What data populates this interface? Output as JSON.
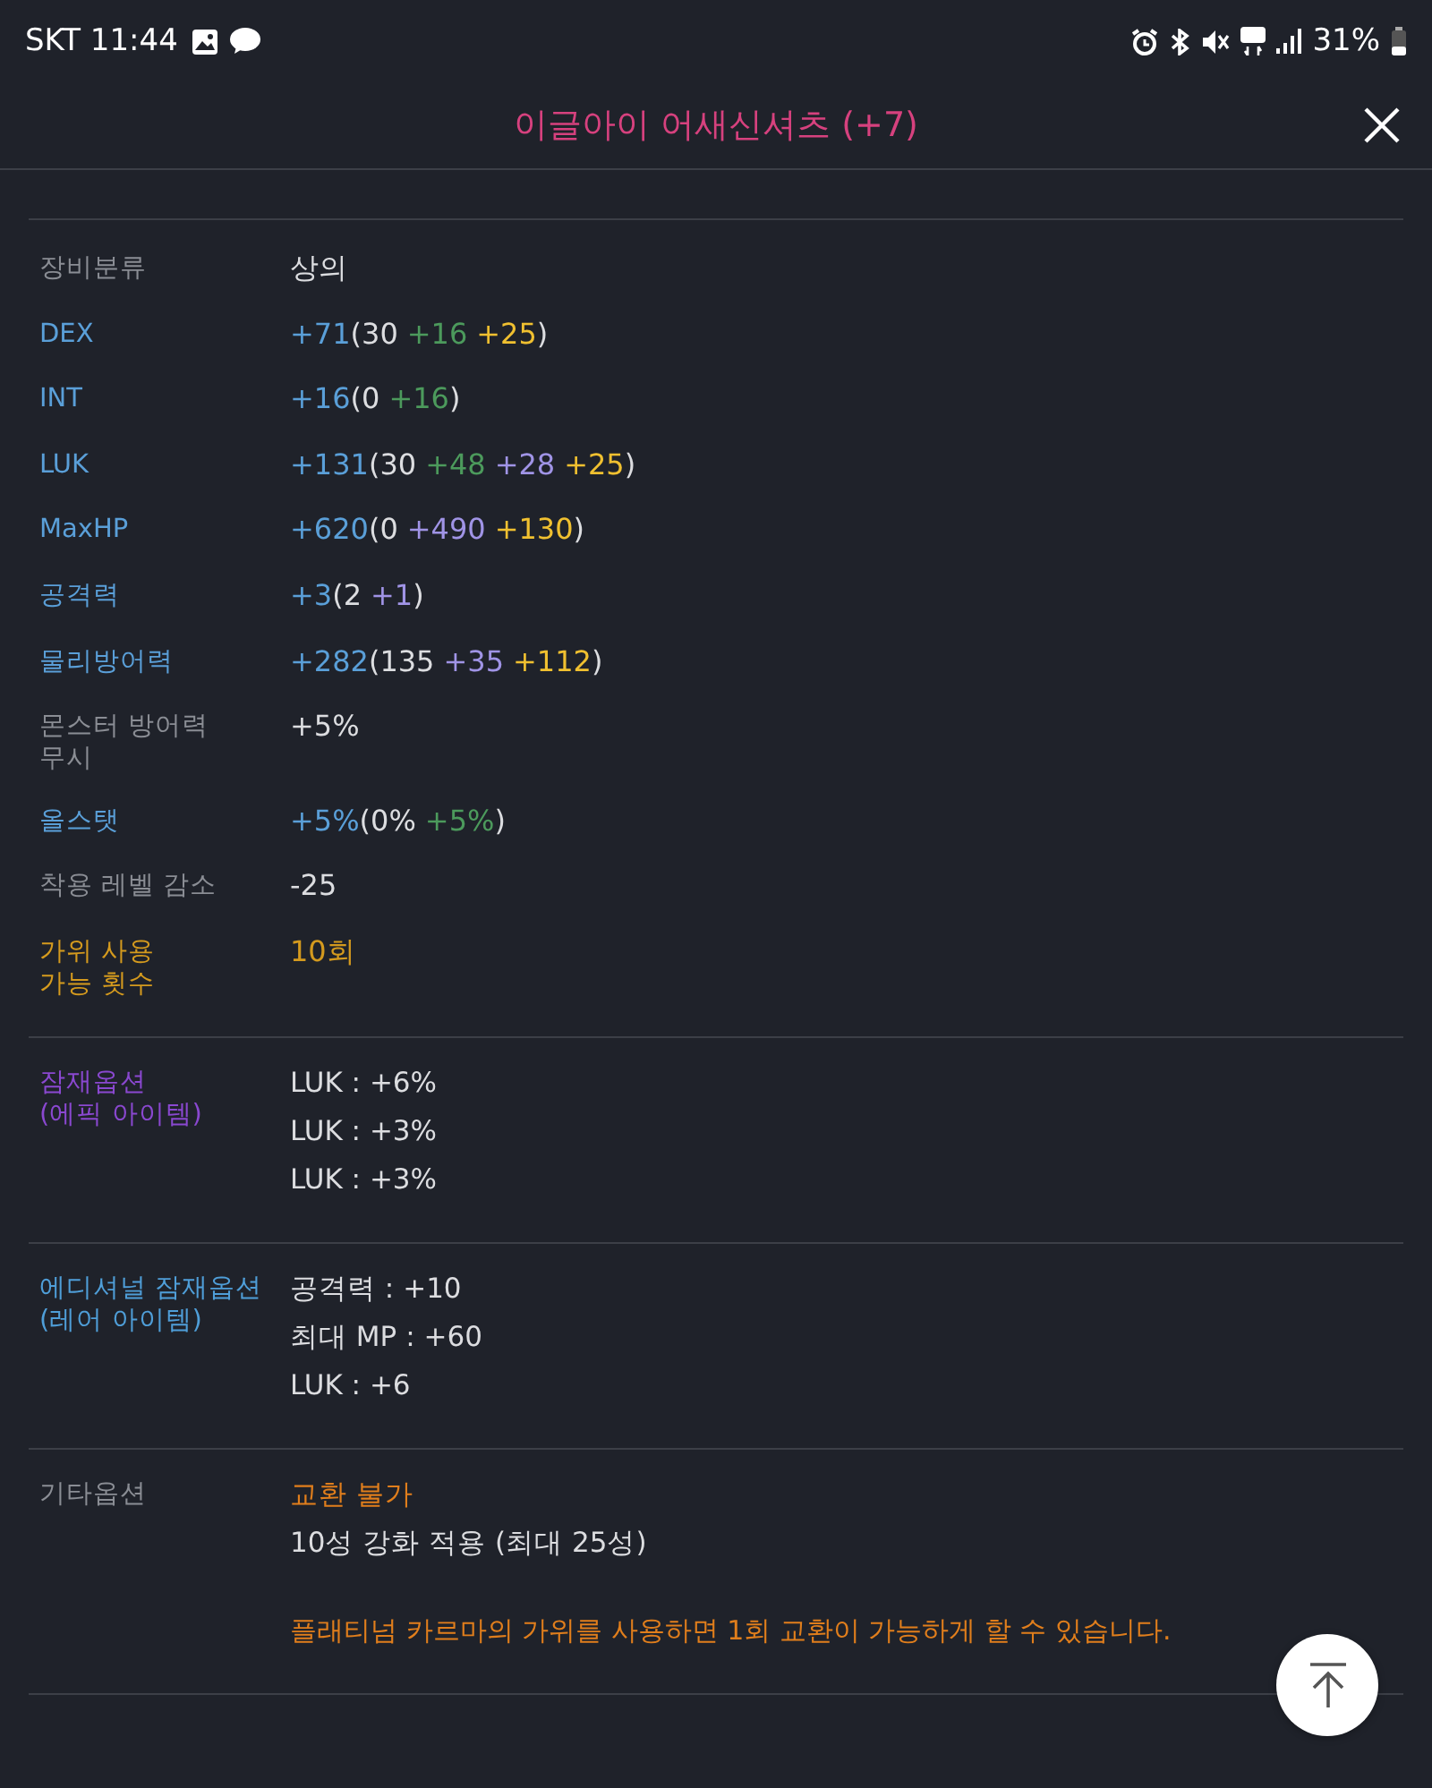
{
  "status_bar": {
    "carrier_time": "SKT 11:44",
    "battery": "31%"
  },
  "header": {
    "title": "이글아이 어새신셔츠 (+7)"
  },
  "sections": [
    {
      "rows": [
        {
          "label": [
            "장비분류"
          ],
          "color": "#8a8d94",
          "value": [
            {
              "text": "상의",
              "color": "#dcdde0"
            }
          ]
        },
        {
          "label": [
            "DEX"
          ],
          "color": "#5a9fd8",
          "value": [
            {
              "text": "+71",
              "color": "#5a9fd8"
            },
            {
              "text": "(30",
              "color": "#dcdde0"
            },
            {
              "text": "+16",
              "color": "#4c9a5c"
            },
            {
              "text": "+25",
              "color": "#f0c030"
            },
            {
              "text": ")",
              "color": "#dcdde0"
            }
          ]
        },
        {
          "label": [
            "INT"
          ],
          "color": "#5a9fd8",
          "value": [
            {
              "text": "+16",
              "color": "#5a9fd8"
            },
            {
              "text": "(0",
              "color": "#dcdde0"
            },
            {
              "text": "+16",
              "color": "#4c9a5c"
            },
            {
              "text": ")",
              "color": "#dcdde0"
            }
          ]
        },
        {
          "label": [
            "LUK"
          ],
          "color": "#5a9fd8",
          "value": [
            {
              "text": "+131",
              "color": "#5a9fd8"
            },
            {
              "text": "(30",
              "color": "#dcdde0"
            },
            {
              "text": "+48",
              "color": "#4c9a5c"
            },
            {
              "text": "+28",
              "color": "#a094e6"
            },
            {
              "text": "+25",
              "color": "#f0c030"
            },
            {
              "text": ")",
              "color": "#dcdde0"
            }
          ]
        },
        {
          "label": [
            "MaxHP"
          ],
          "color": "#5a9fd8",
          "value": [
            {
              "text": "+620",
              "color": "#5a9fd8"
            },
            {
              "text": "(0",
              "color": "#dcdde0"
            },
            {
              "text": "+490",
              "color": "#a094e6"
            },
            {
              "text": "+130",
              "color": "#f0c030"
            },
            {
              "text": ")",
              "color": "#dcdde0"
            }
          ]
        },
        {
          "label": [
            "공격력"
          ],
          "color": "#5a9fd8",
          "value": [
            {
              "text": "+3",
              "color": "#5a9fd8"
            },
            {
              "text": "(2",
              "color": "#dcdde0"
            },
            {
              "text": "+1",
              "color": "#a094e6"
            },
            {
              "text": ")",
              "color": "#dcdde0"
            }
          ]
        },
        {
          "label": [
            "물리방어력"
          ],
          "color": "#5a9fd8",
          "value": [
            {
              "text": "+282",
              "color": "#5a9fd8"
            },
            {
              "text": "(135",
              "color": "#dcdde0"
            },
            {
              "text": "+35",
              "color": "#a094e6"
            },
            {
              "text": "+112",
              "color": "#f0c030"
            },
            {
              "text": ")",
              "color": "#dcdde0"
            }
          ]
        },
        {
          "label": [
            "몬스터 방어력",
            "무시"
          ],
          "color": "#8a8d94",
          "value": [
            {
              "text": "+5%",
              "color": "#dcdde0"
            }
          ]
        },
        {
          "label": [
            "올스탯"
          ],
          "color": "#5a9fd8",
          "value": [
            {
              "text": "+5%",
              "color": "#5a9fd8"
            },
            {
              "text": "(0%",
              "color": "#dcdde0"
            },
            {
              "text": "+5%",
              "color": "#4c9a5c"
            },
            {
              "text": ")",
              "color": "#dcdde0"
            }
          ]
        },
        {
          "label": [
            "착용 레벨 감소"
          ],
          "color": "#8a8d94",
          "value": [
            {
              "text": "-25",
              "color": "#dcdde0"
            }
          ]
        },
        {
          "label": [
            "가위 사용",
            "가능 횟수"
          ],
          "color": "#d49a1e",
          "value": [
            {
              "text": "10회",
              "color": "#d49a1e"
            }
          ]
        }
      ]
    },
    {
      "rows": [
        {
          "label": [
            "잠재옵션",
            "(에픽 아이템)"
          ],
          "color": "#8a48d0",
          "lines": [
            {
              "text": "LUK : +6%",
              "color": "#dcdde0"
            },
            {
              "text": "LUK : +3%",
              "color": "#dcdde0"
            },
            {
              "text": "LUK : +3%",
              "color": "#dcdde0"
            }
          ]
        }
      ]
    },
    {
      "rows": [
        {
          "label": [
            "에디셔널 잠재옵션",
            "(레어 아이템)"
          ],
          "color": "#4f9ed8",
          "lines": [
            {
              "text": "공격력 : +10",
              "color": "#dcdde0"
            },
            {
              "text": "최대 MP : +60",
              "color": "#dcdde0"
            },
            {
              "text": "LUK : +6",
              "color": "#dcdde0"
            }
          ]
        }
      ]
    },
    {
      "rows": [
        {
          "label": [
            "기타옵션"
          ],
          "color": "#8a8d94",
          "lines": [
            {
              "text": "교환 불가",
              "color": "#e07e1c"
            },
            {
              "text": "10성 강화 적용 (최대 25성)",
              "color": "#dcdde0"
            }
          ],
          "note": {
            "text": "플래티넘 카르마의 가위를 사용하면 1회 교환이 가능하게 할 수 있습니다.",
            "color": "#e07e1c"
          }
        }
      ]
    }
  ]
}
